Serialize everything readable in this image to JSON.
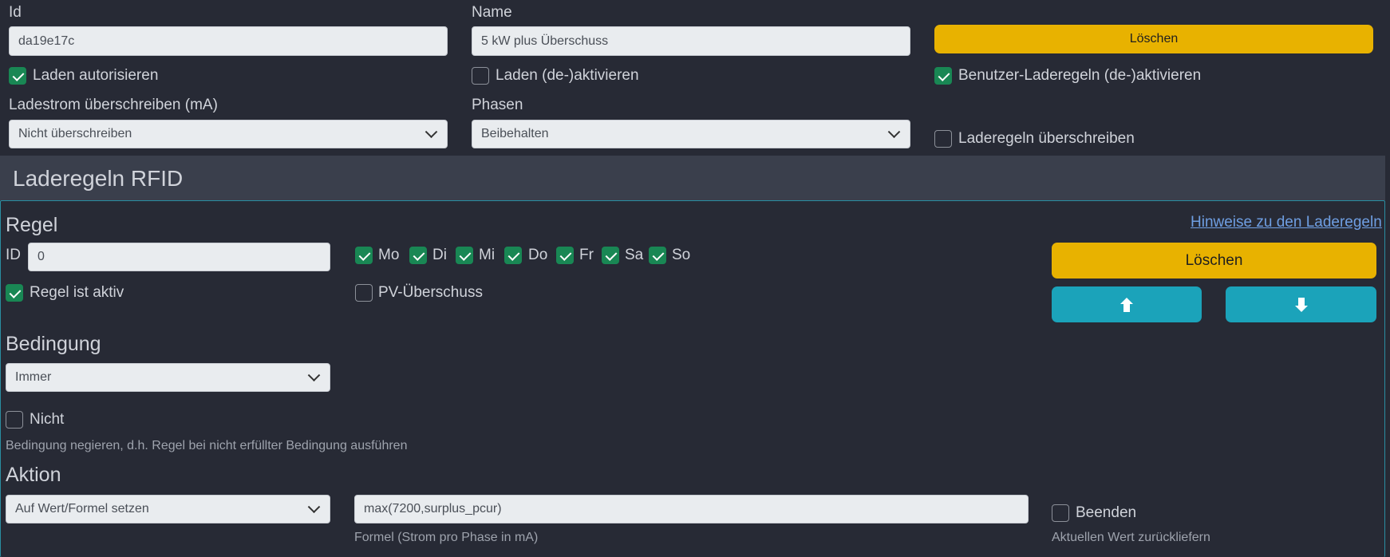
{
  "top": {
    "id_label": "Id",
    "id_value": "da19e17c",
    "name_label": "Name",
    "name_value": "5 kW plus Überschuss",
    "delete_label": "Löschen",
    "authorize_label": "Laden autorisieren",
    "authorize_checked": true,
    "activate_label": "Laden (de-)aktivieren",
    "activate_checked": false,
    "user_rules_label": "Benutzer-Laderegeln (de-)aktivieren",
    "user_rules_checked": true,
    "current_label": "Ladestrom überschreiben (mA)",
    "current_value": "Nicht überschreiben",
    "phases_label": "Phasen",
    "phases_value": "Beibehalten",
    "override_rules_label": "Laderegeln überschreiben",
    "override_rules_checked": false
  },
  "section_title": "Laderegeln RFID",
  "rule": {
    "heading": "Regel",
    "hint_link": "Hinweise zu den Laderegeln",
    "id_label": "ID",
    "id_value": "0",
    "days": [
      {
        "label": "Mo",
        "checked": true
      },
      {
        "label": "Di",
        "checked": true
      },
      {
        "label": "Mi",
        "checked": true
      },
      {
        "label": "Do",
        "checked": true
      },
      {
        "label": "Fr",
        "checked": true
      },
      {
        "label": "Sa",
        "checked": true
      },
      {
        "label": "So",
        "checked": true
      }
    ],
    "active_label": "Regel ist aktiv",
    "active_checked": true,
    "pv_label": "PV-Überschuss",
    "pv_checked": false,
    "delete_label": "Löschen",
    "up_icon": "arrow-up-icon",
    "down_icon": "arrow-down-icon"
  },
  "condition": {
    "heading": "Bedingung",
    "value": "Immer",
    "not_label": "Nicht",
    "not_checked": false,
    "not_help": "Bedingung negieren, d.h. Regel bei nicht erfüllter Bedingung ausführen"
  },
  "action": {
    "heading": "Aktion",
    "value": "Auf Wert/Formel setzen",
    "formula_value": "max(7200,surplus_pcur)",
    "formula_help": "Formel (Strom pro Phase in mA)",
    "end_label": "Beenden",
    "end_checked": false,
    "end_help": "Aktuellen Wert zurückliefern"
  },
  "colors": {
    "background": "#272a35",
    "band": "#3a3f4c",
    "yellow": "#e8b200",
    "cyan": "#1ba3ba",
    "green": "#198754",
    "link": "#6f9fe3"
  }
}
